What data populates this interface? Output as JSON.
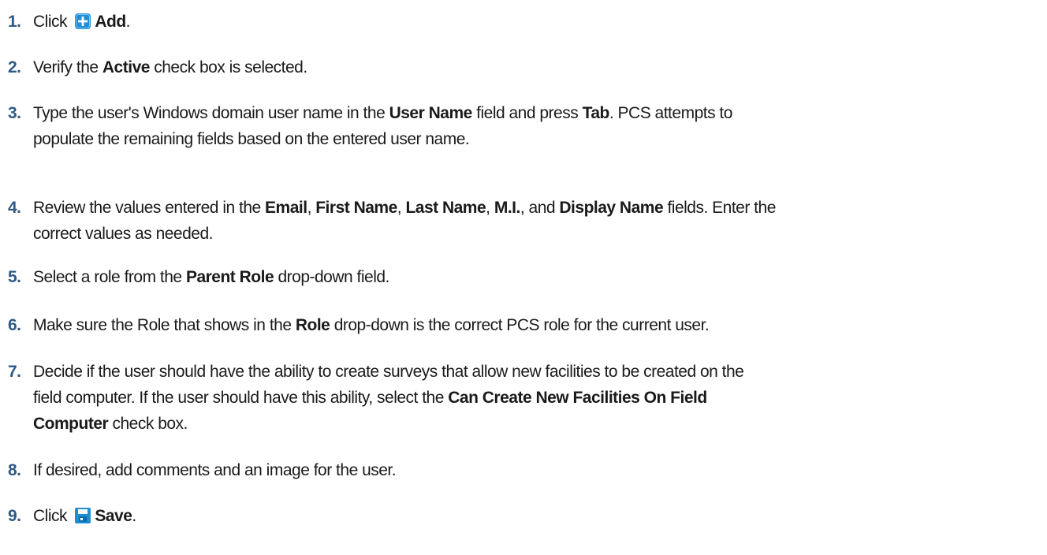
{
  "steps": [
    {
      "num": "1.",
      "parts": [
        {
          "t": "Click "
        },
        {
          "icon": "add-icon"
        },
        {
          "b": "Add"
        },
        {
          "t": "."
        }
      ]
    },
    {
      "num": "2.",
      "parts": [
        {
          "t": "Verify the "
        },
        {
          "b": "Active"
        },
        {
          "t": " check box is selected."
        }
      ]
    },
    {
      "num": "3.",
      "lines": [
        [
          {
            "t": "Type the user's Windows domain user name in the "
          },
          {
            "b": "User Name"
          },
          {
            "t": " field and press "
          },
          {
            "b": "Tab"
          },
          {
            "t": ". PCS attempts to"
          }
        ],
        [
          {
            "t": "populate the remaining fields based on the entered user name."
          }
        ]
      ]
    },
    {
      "num": "4.",
      "lines": [
        [
          {
            "t": "Review the values entered in the "
          },
          {
            "b": "Email"
          },
          {
            "t": ", "
          },
          {
            "b": "First Name"
          },
          {
            "t": ", "
          },
          {
            "b": "Last Name"
          },
          {
            "t": ", "
          },
          {
            "b": "M.I."
          },
          {
            "t": ", and "
          },
          {
            "b": "Display Name"
          },
          {
            "t": " fields. Enter the"
          }
        ],
        [
          {
            "t": "correct values as needed."
          }
        ]
      ]
    },
    {
      "num": "5.",
      "parts": [
        {
          "t": "Select a role from the "
        },
        {
          "b": "Parent Role"
        },
        {
          "t": " drop-down field."
        }
      ]
    },
    {
      "num": "6.",
      "parts": [
        {
          "t": "Make sure the Role that shows in the "
        },
        {
          "b": "Role"
        },
        {
          "t": " drop-down is the correct PCS role for the current user."
        }
      ]
    },
    {
      "num": "7.",
      "lines": [
        [
          {
            "t": "Decide if the user should have the ability to create surveys that allow new facilities to be created on the"
          }
        ],
        [
          {
            "t": "field computer. If the user should have this ability, select the "
          },
          {
            "b": "Can Create New Facilities On Field"
          }
        ],
        [
          {
            "b": "Computer"
          },
          {
            "t": " check box."
          }
        ]
      ]
    },
    {
      "num": "8.",
      "parts": [
        {
          "t": "If desired, add comments and an image for the user."
        }
      ]
    },
    {
      "num": "9.",
      "parts": [
        {
          "t": "Click "
        },
        {
          "icon": "save-icon"
        },
        {
          "b": "Save"
        },
        {
          "t": "."
        }
      ]
    }
  ],
  "colors": {
    "number": "#2d5a86",
    "icon_blue": "#1e8fd6"
  }
}
